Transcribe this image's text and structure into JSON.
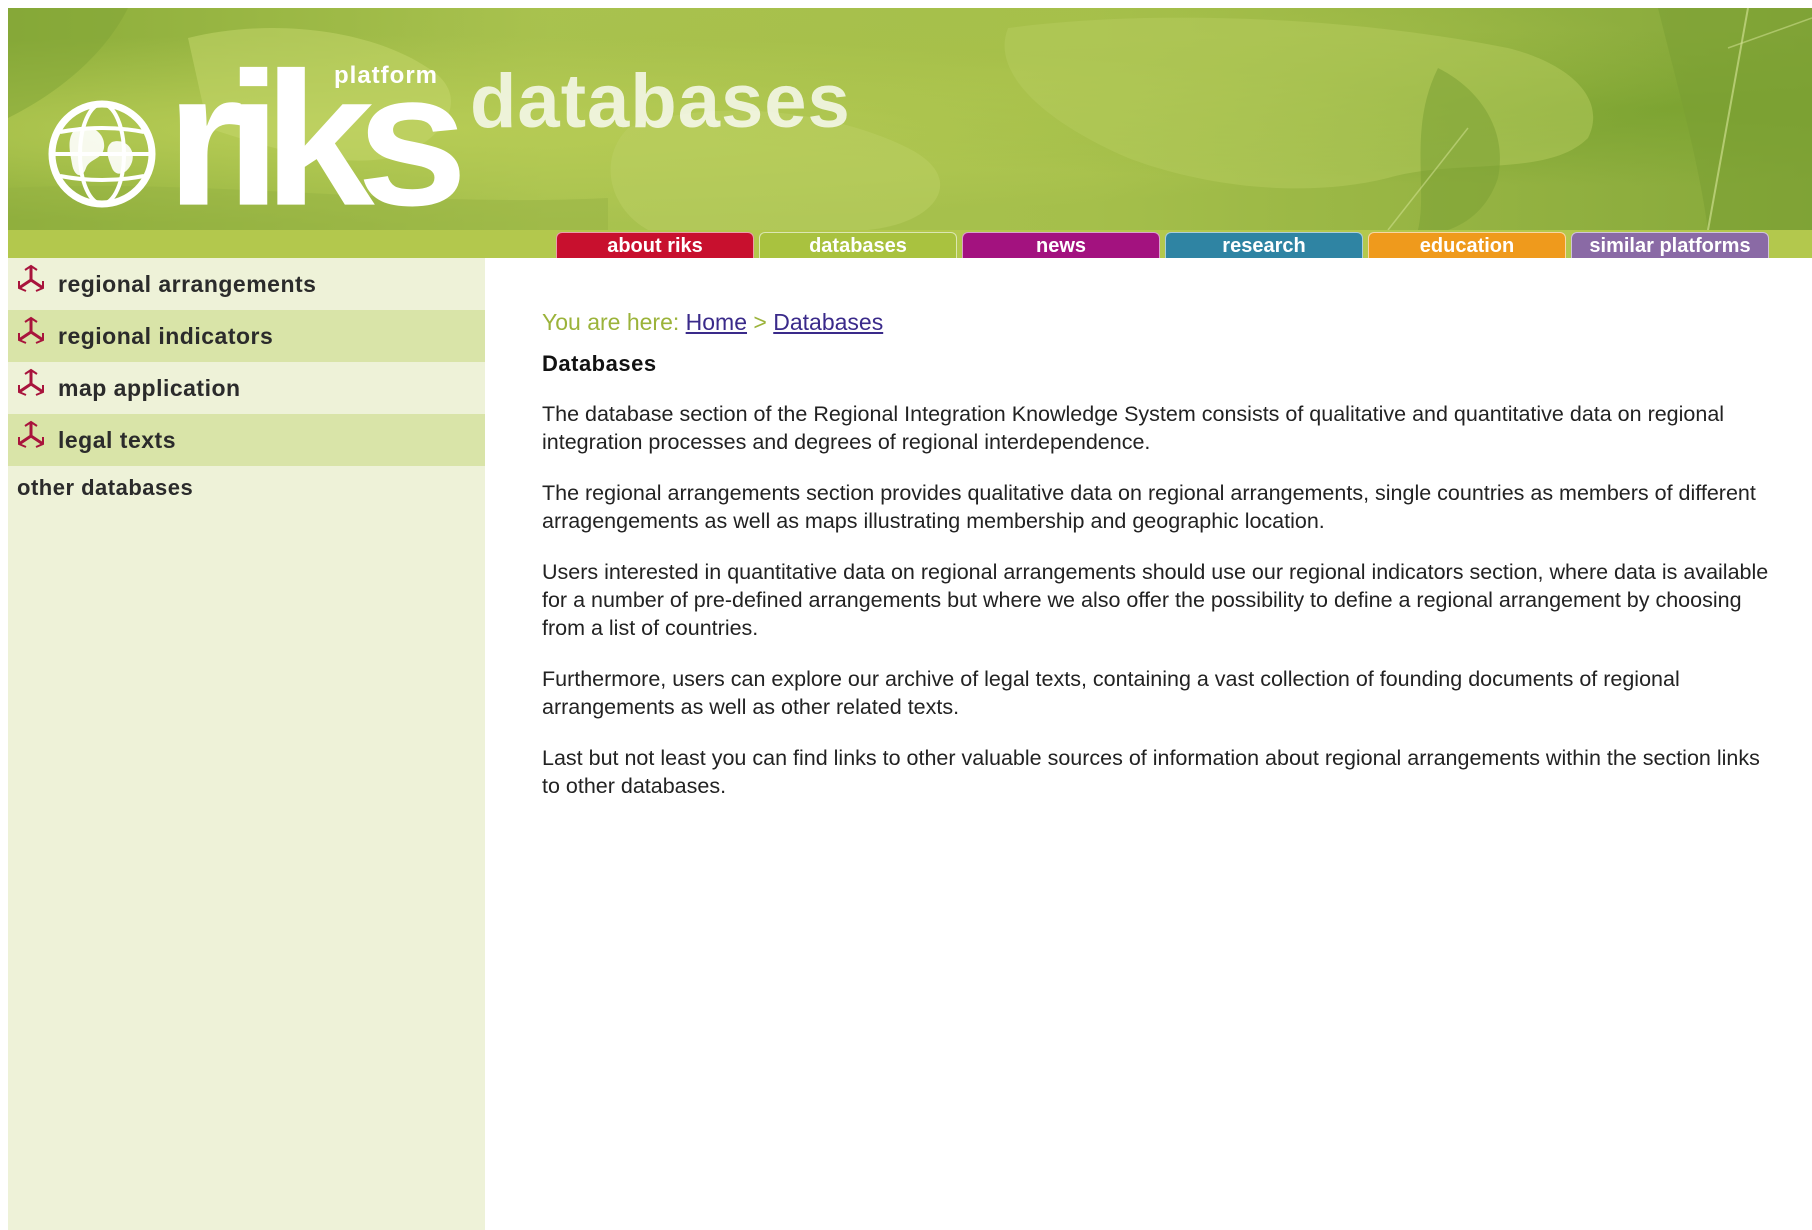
{
  "header": {
    "logo_text": "riks",
    "logo_superscript": "platform",
    "section_title": "databases"
  },
  "tabs": [
    {
      "label": "about riks",
      "color": "#c8102e"
    },
    {
      "label": "databases",
      "color": "#a9c23f"
    },
    {
      "label": "news",
      "color": "#a3127f"
    },
    {
      "label": "research",
      "color": "#2f84a3"
    },
    {
      "label": "education",
      "color": "#ef9a1c"
    },
    {
      "label": "similar platforms",
      "color": "#8a6aa5"
    }
  ],
  "sidebar": {
    "items": [
      {
        "label": "regional arrangements",
        "icon": "triskelion-icon"
      },
      {
        "label": "regional indicators",
        "icon": "triskelion-icon"
      },
      {
        "label": "map application",
        "icon": "triskelion-icon"
      },
      {
        "label": "legal texts",
        "icon": "triskelion-icon"
      }
    ],
    "other": "other databases"
  },
  "breadcrumb": {
    "prefix": "You are here: ",
    "home": "Home",
    "separator": " > ",
    "current": "Databases"
  },
  "main": {
    "title": "Databases",
    "paragraphs": [
      "The database section of the Regional Integration Knowledge System consists of qualitative and quantitative data on regional integration processes and degrees of regional interdependence.",
      "The regional arrangements section provides qualitative data on regional arrangements, single countries as members of different arragengements as well as maps illustrating membership and geographic location.",
      "Users interested in quantitative data on regional arrangements should use our regional indicators section, where data is available for a number of pre-defined arrangements but where we also offer the possibility to define a regional arrangement by choosing from a list of countries.",
      "Furthermore, users can explore our archive of legal texts, containing a vast collection of founding documents of regional arrangements as well as other related texts.",
      "Last but not least you can find links to other valuable sources of information about regional arrangements within the section links to other databases."
    ]
  },
  "colors": {
    "banner": "#a9c24f",
    "strip": "#b3c84d",
    "sidebar_bg": "#eef2d8",
    "sidebar_alt": "#d9e4a8",
    "breadcrumb": "#9bb33a",
    "link": "#3a2a8a",
    "icon": "#a8143c"
  }
}
